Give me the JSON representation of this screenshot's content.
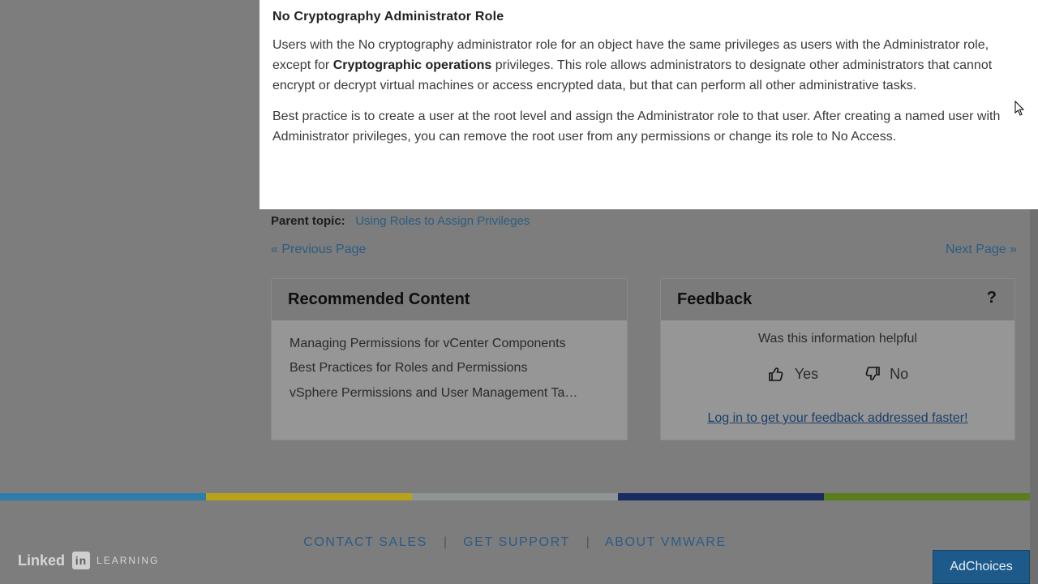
{
  "doc": {
    "heading": "No Cryptography Administrator Role",
    "para1_a": "Users with the No cryptography administrator role for an object have the same privileges as users with the Administrator role, except for ",
    "para1_b": "Cryptographic operations",
    "para1_c": " privileges. This role allows administrators to designate other administrators that cannot encrypt or decrypt virtual machines or access encrypted data, but that can perform all other administrative tasks.",
    "para2": "Best practice is to create a user at the root level and assign the Administrator role to that user. After creating a named user with Administrator privileges, you can remove the root user from any permissions or change its role to No Access."
  },
  "parent_topic": {
    "label": "Parent topic:",
    "link": "Using Roles to Assign Privileges"
  },
  "nav": {
    "prev": "« Previous Page",
    "next": "Next Page »"
  },
  "recommended": {
    "title": "Recommended Content",
    "items": [
      "Managing Permissions for vCenter Components",
      "Best Practices for Roles and Permissions",
      "vSphere Permissions and User Management Ta…"
    ]
  },
  "feedback": {
    "title": "Feedback",
    "help_icon": "?",
    "question": "Was this information helpful",
    "yes": "Yes",
    "no": "No",
    "login": "Log in to get your feedback addressed faster!"
  },
  "footer": {
    "contact": "CONTACT SALES",
    "support": "GET SUPPORT",
    "about": "ABOUT VMWARE"
  },
  "adchoices": "AdChoices",
  "watermark": {
    "linked": "Linked",
    "in": "in",
    "learning": "LEARNING"
  }
}
